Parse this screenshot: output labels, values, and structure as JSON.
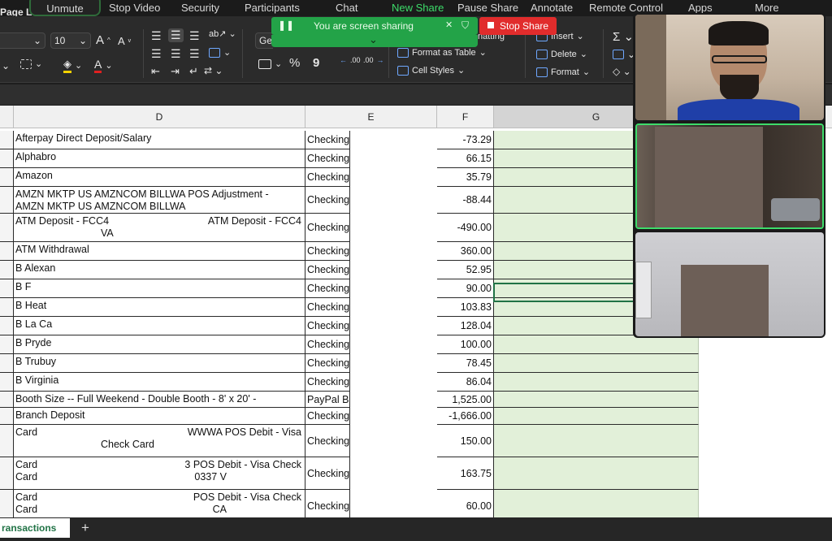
{
  "zoom_toolbar": {
    "unmute": "Unmute",
    "stop_video": "Stop Video",
    "security": "Security",
    "participants": "Participants",
    "chat": "Chat",
    "new_share": "New Share",
    "pause_share": "Pause Share",
    "annotate": "Annotate",
    "remote_control": "Remote Control",
    "apps": "Apps",
    "more": "More",
    "page_layout_partial": "Page L"
  },
  "share_banner": {
    "text": "You are screen sharing",
    "stop_share": "Stop Share",
    "accent": "#23a348",
    "stop_color": "#e12c2c"
  },
  "ribbon": {
    "font_partial": "Ge",
    "font_size": "10",
    "conditional_formatting_partial": "natting",
    "format_as_table": "Format as Table",
    "cell_styles": "Cell Styles",
    "insert": "Insert",
    "delete": "Delete",
    "format": "Format",
    "percent": "%",
    "comma": "9",
    "inc_decimal": ".00",
    "dec_decimal": ".00"
  },
  "sheet": {
    "columns": [
      "D",
      "E",
      "F",
      "G"
    ],
    "rows": [
      {
        "d": [
          "Afterpay Direct Deposit/Salary"
        ],
        "e": "Checking",
        "f": "-73.29"
      },
      {
        "d": [
          "Alphabro"
        ],
        "e": "Checking",
        "f": "66.15"
      },
      {
        "d": [
          "Amazon"
        ],
        "e": "Checking",
        "f": "35.79"
      },
      {
        "d": [
          "AMZN MKTP US AMZNCOM BILLWA POS Adjustment -",
          "AMZN MKTP US AMZNCOM BILLWA"
        ],
        "e": "Checking",
        "f": "-88.44"
      },
      {
        "d": [
          "ATM Deposit - FCC4",
          "VA"
        ],
        "d_right": "ATM Deposit - FCC4",
        "e": "Checking",
        "f": "-490.00"
      },
      {
        "d": [
          "ATM Withdrawal"
        ],
        "e": "Checking",
        "f": "360.00"
      },
      {
        "d": [
          "B Alexan"
        ],
        "e": "Checking",
        "f": "52.95"
      },
      {
        "d": [
          "B F"
        ],
        "e": "Checking",
        "f": "90.00"
      },
      {
        "d": [
          "B Heat"
        ],
        "e": "Checking",
        "f": "103.83"
      },
      {
        "d": [
          "B La Ca"
        ],
        "e": "Checking",
        "f": "128.04"
      },
      {
        "d": [
          "B Pryde"
        ],
        "e": "Checking",
        "f": "100.00"
      },
      {
        "d": [
          "B Trubuy"
        ],
        "e": "Checking",
        "f": "78.45"
      },
      {
        "d": [
          "B Virginia"
        ],
        "e": "Checking",
        "f": "86.04"
      },
      {
        "d": [
          "Booth Size -- Full Weekend - Double Booth - 8' x 20' -"
        ],
        "e": "PayPal B",
        "f": "1,525.00"
      },
      {
        "d": [
          "Branch Deposit"
        ],
        "e": "Checking",
        "f": "-1,666.00"
      },
      {
        "d": [
          "Card",
          "Check Card"
        ],
        "d_right": "WWWA POS Debit - Visa",
        "e": "Checking",
        "f": "150.00"
      },
      {
        "d": [
          "Card",
          "Card"
        ],
        "d_right": "3 POS Debit - Visa Check",
        "d_right2": "0337 V",
        "e": "Checking",
        "f": "163.75"
      },
      {
        "d": [
          "Card",
          "Card"
        ],
        "d_right": "POS Debit - Visa Check",
        "d_right2": "CA",
        "e": "Checking",
        "f": "60.00"
      }
    ]
  },
  "sheet_tab": {
    "active": "ransactions",
    "add": "+"
  }
}
